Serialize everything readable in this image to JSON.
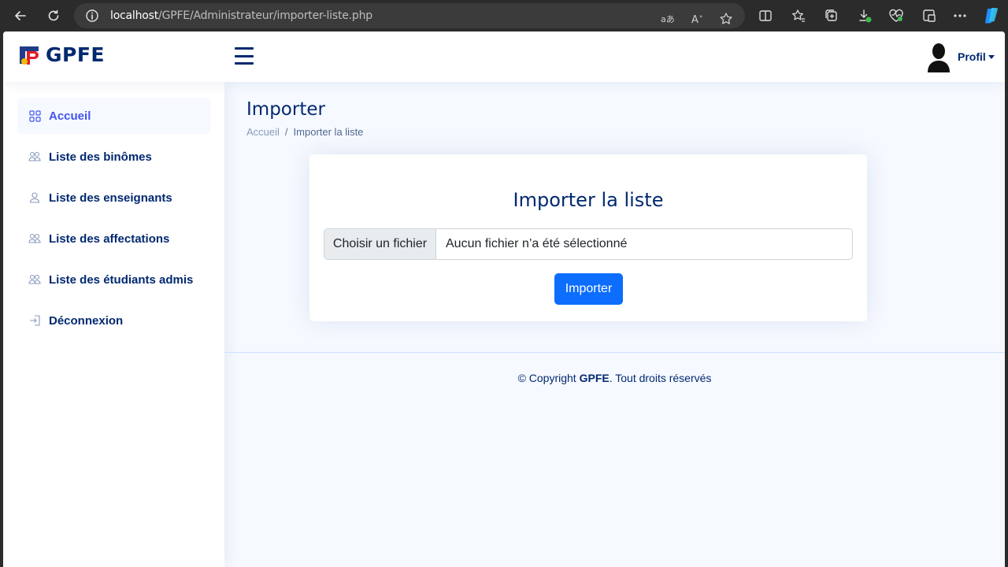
{
  "browser": {
    "url_host": "localhost",
    "url_path": "/GPFE/Administrateur/importer-liste.php"
  },
  "header": {
    "logo_text": "GPFE",
    "profile_label": "Profil"
  },
  "sidebar": {
    "items": [
      {
        "label": "Accueil",
        "icon": "grid-icon",
        "active": true
      },
      {
        "label": "Liste des binômes",
        "icon": "people-icon"
      },
      {
        "label": "Liste des enseignants",
        "icon": "person-icon"
      },
      {
        "label": "Liste des affectations",
        "icon": "people-icon"
      },
      {
        "label": "Liste des étudiants admis",
        "icon": "people-icon"
      },
      {
        "label": "Déconnexion",
        "icon": "box-arrow-in-right-icon"
      }
    ]
  },
  "main": {
    "page_title": "Importer",
    "breadcrumb": {
      "home": "Accueil",
      "separator": "/",
      "current": "Importer la liste"
    },
    "card": {
      "title": "Importer la liste",
      "file_button_label": "Choisir un fichier",
      "file_status": "Aucun fichier n’a été sélectionné",
      "submit_label": "Importer"
    }
  },
  "footer": {
    "prefix": "© Copyright ",
    "brand": "GPFE",
    "suffix": ". Tout droits réservés"
  },
  "colors": {
    "brand_navy": "#012970",
    "accent_blue": "#4154f1",
    "primary_button": "#0d6efd",
    "page_background": "#f6f9ff"
  }
}
